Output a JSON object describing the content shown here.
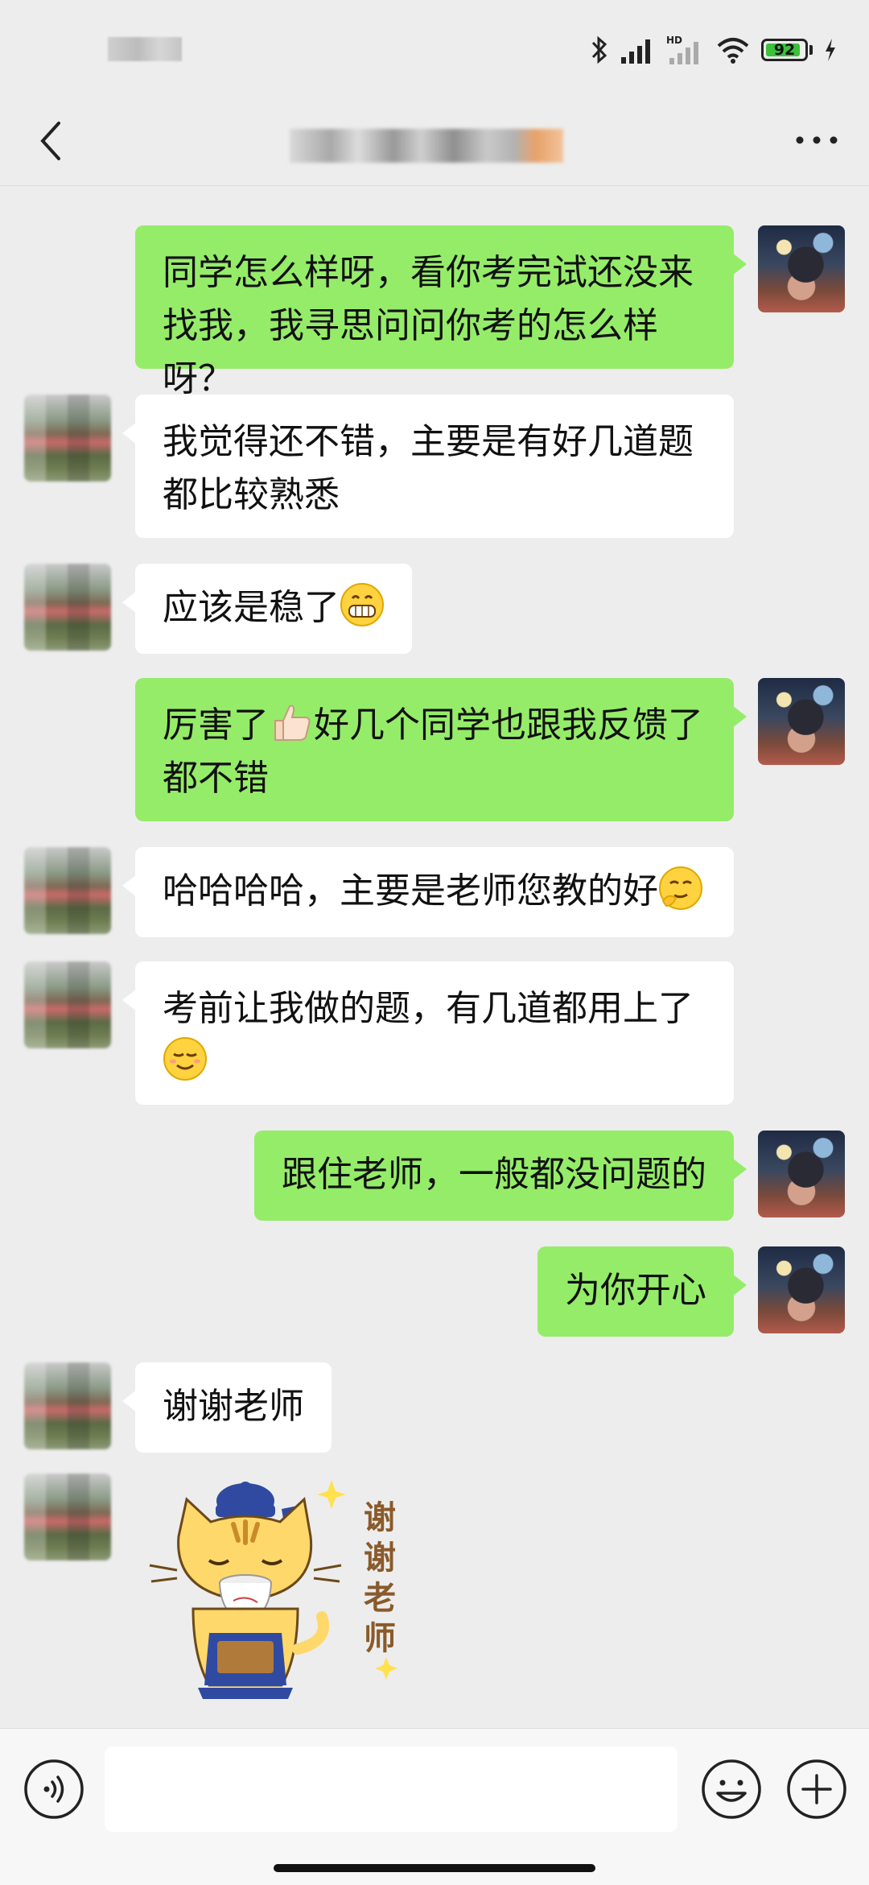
{
  "status_bar": {
    "battery_level": "92"
  },
  "nav": {
    "back_label": "<",
    "more_label": "..."
  },
  "messages": [
    {
      "sender": "me",
      "text": "同学怎么样呀，看你考完试还没来找我，我寻思问问你考的怎么样呀？"
    },
    {
      "sender": "them",
      "text": "我觉得还不错，主要是有好几道题都比较熟悉"
    },
    {
      "sender": "them",
      "text": "应该是稳了",
      "emoji": "grin-emoji"
    },
    {
      "sender": "me",
      "text_before": "厉害了",
      "emoji": "thumbs-up-emoji",
      "text_after": "好几个同学也跟我反馈了都不错"
    },
    {
      "sender": "them",
      "text": "哈哈哈哈，主要是老师您教的好",
      "emoji": "shy-emoji"
    },
    {
      "sender": "them",
      "text": "考前让我做的题，有几道都用上了",
      "emoji": "smirk-emoji"
    },
    {
      "sender": "me",
      "text": "跟住老师，一般都没问题的"
    },
    {
      "sender": "me",
      "text": "为你开心"
    },
    {
      "sender": "them",
      "text": "谢谢老师"
    }
  ],
  "sticker": {
    "text": "谢谢老师",
    "description_icon": "cat-tea-sticker"
  },
  "input_bar": {
    "placeholder": ""
  },
  "colors": {
    "my_bubble": "#95EC69",
    "their_bubble": "#FFFFFF",
    "background": "#EDEDED"
  }
}
